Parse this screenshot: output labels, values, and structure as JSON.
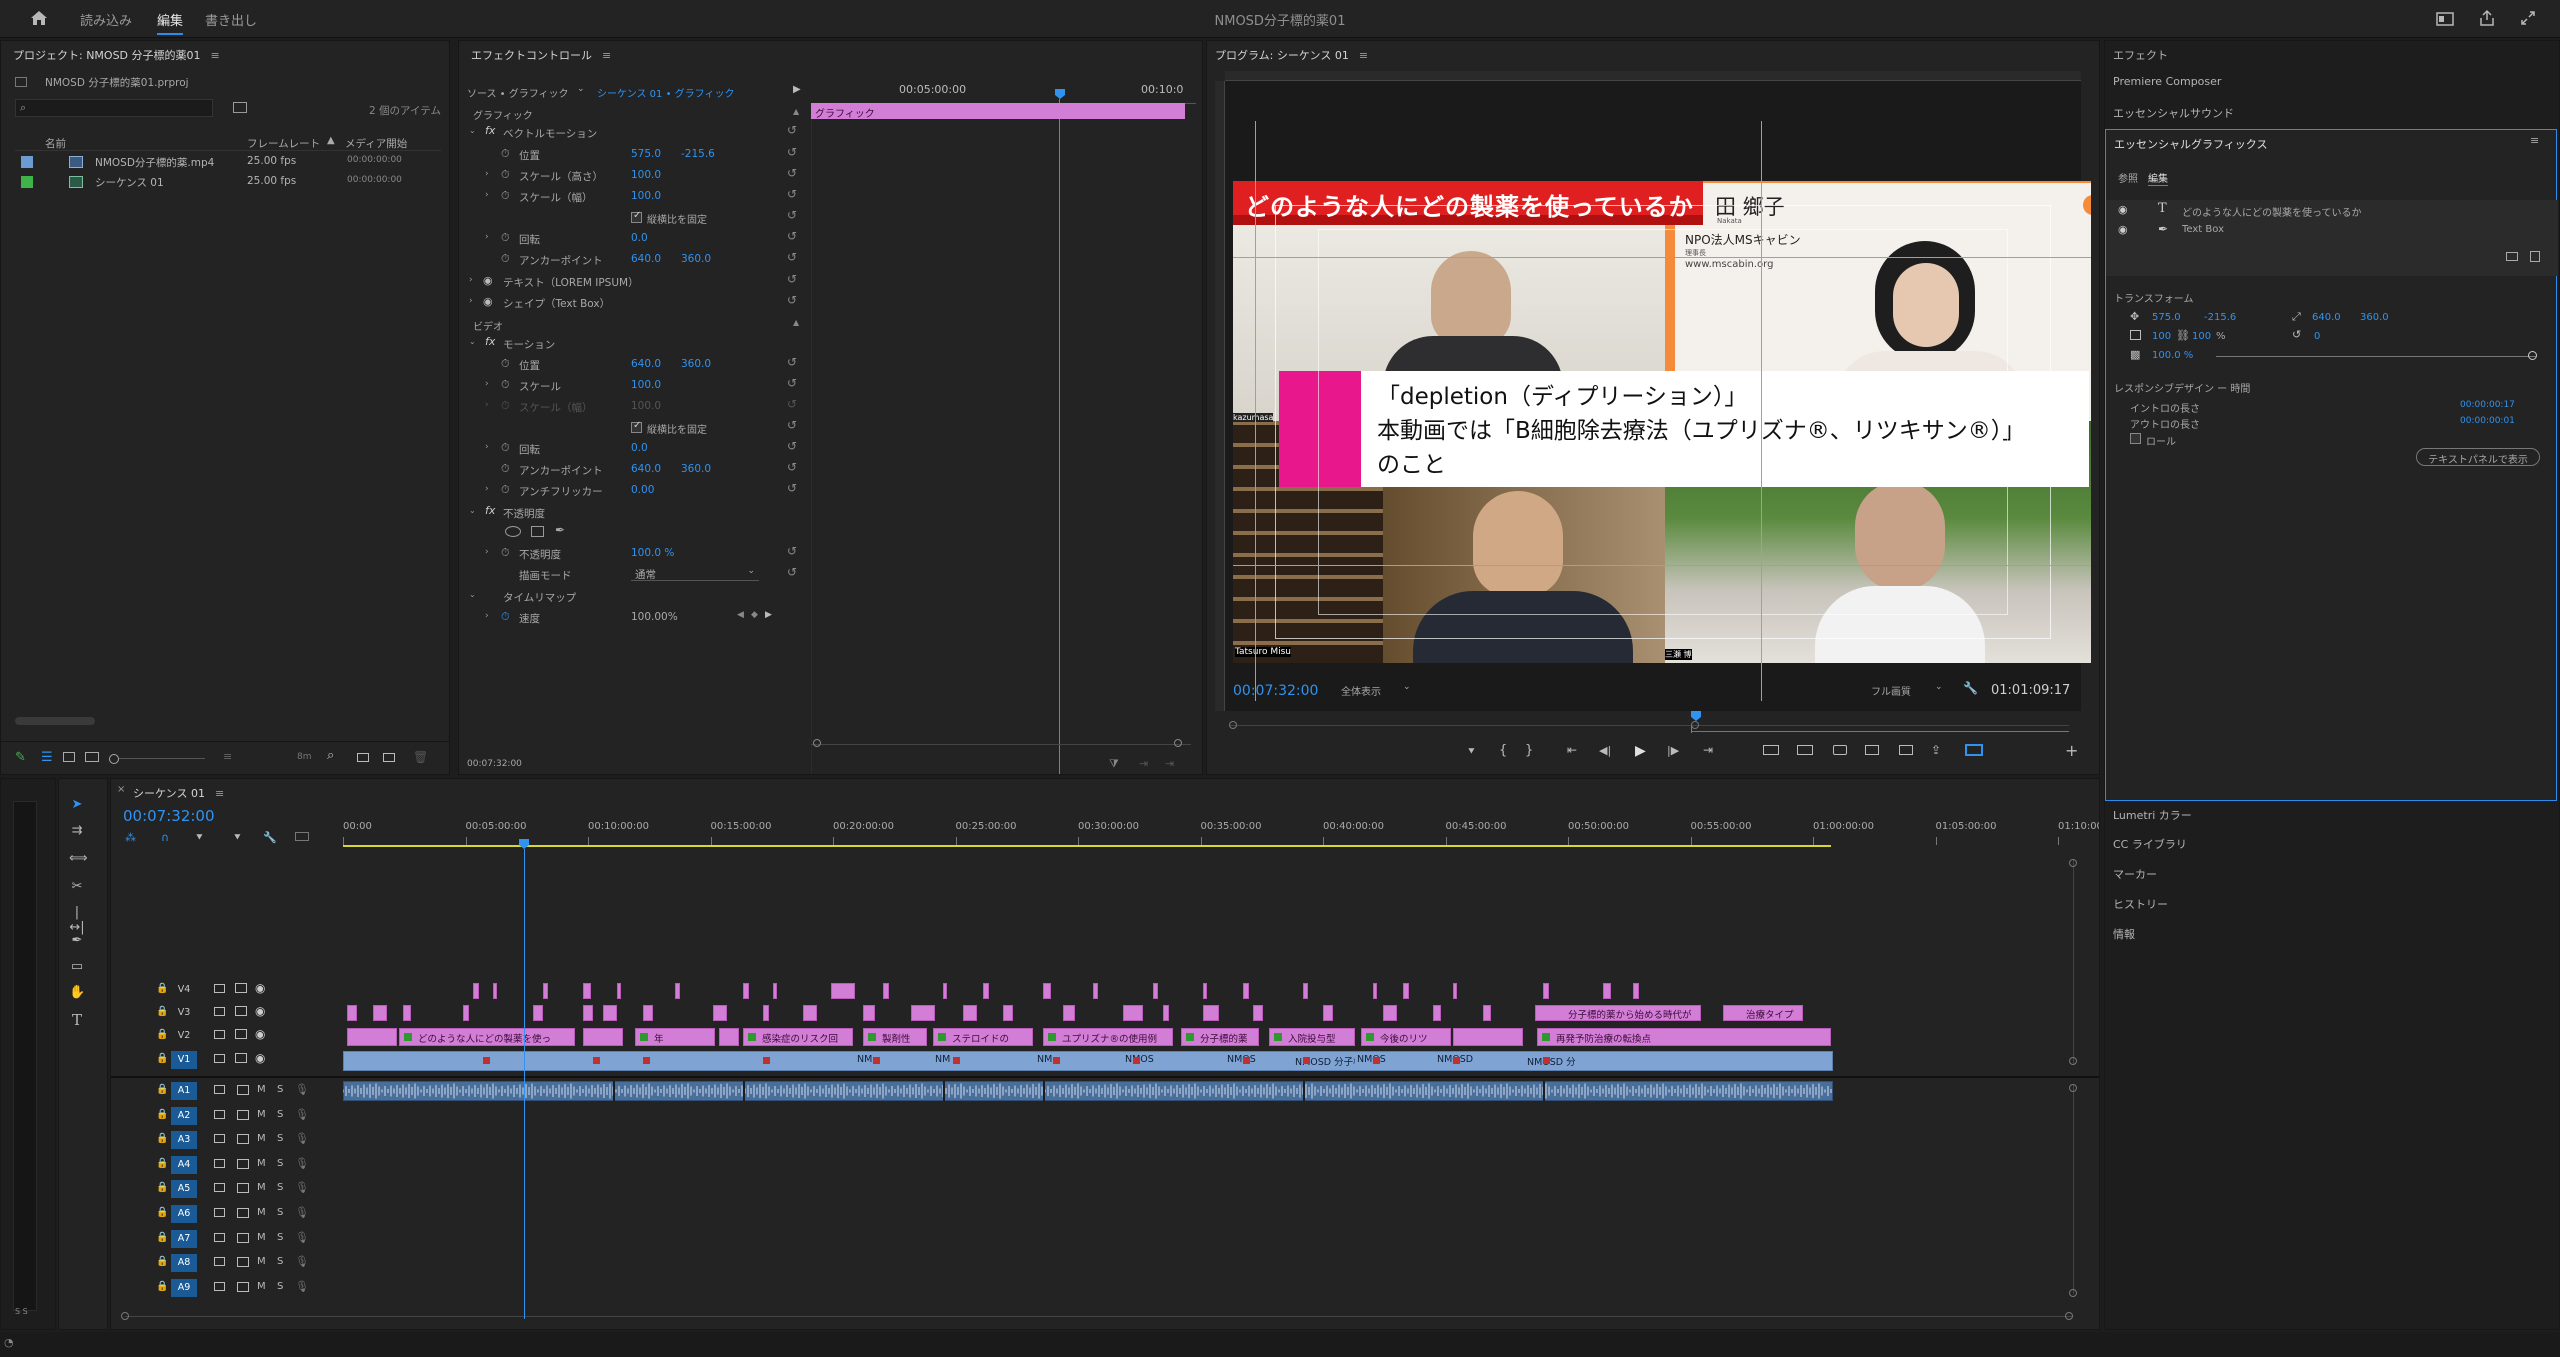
{
  "app": {
    "title": "NMOSD分子標的薬01",
    "workspaces": [
      "読み込み",
      "編集",
      "書き出し"
    ],
    "active_workspace": "編集"
  },
  "project": {
    "title": "プロジェクト: NMOSD 分子標的薬01",
    "file": "NMOSD 分子標的薬01.prproj",
    "item_count": "2 個のアイテム",
    "columns": [
      "名前",
      "フレームレート",
      "メディア開始"
    ],
    "items": [
      {
        "name": "NMOSD分子標的薬.mp4",
        "fps": "25.00 fps",
        "start": "00:00:00:00",
        "color": "#6c9bd2"
      },
      {
        "name": "シーケンス 01",
        "fps": "25.00 fps",
        "start": "00:00:00:00",
        "color": "#3fb24a"
      }
    ],
    "zoom_label": "8m"
  },
  "effect_controls": {
    "title": "エフェクトコントロール",
    "source_label": "ソース • グラフィック",
    "sequence_label": "シーケンス 01 • グラフィック",
    "ruler_time": "00:05:00:00",
    "ruler_time2": "00:10:0",
    "clip_label": "グラフィック",
    "footer_time": "00:07:32:00",
    "section_graphic": "グラフィック",
    "vector_motion": "ベクトルモーション",
    "position_label": "位置",
    "position_x": "575.0",
    "position_y": "-215.6",
    "scale_h_label": "スケール（高さ）",
    "scale_h": "100.0",
    "scale_w_label": "スケール（幅）",
    "scale_w": "100.0",
    "uniform_label": "縦横比を固定",
    "rotation_label": "回転",
    "rotation": "0.0",
    "anchor_label": "アンカーポイント",
    "anchor_x": "640.0",
    "anchor_y": "360.0",
    "text_layer": "テキスト（LOREM IPSUM）",
    "shape_layer": "シェイプ（Text Box）",
    "section_video": "ビデオ",
    "motion": "モーション",
    "v_position_x": "640.0",
    "v_position_y": "360.0",
    "v_scale_label": "スケール",
    "v_scale": "100.0",
    "v_scale_w_label": "スケール（幅）",
    "v_scale_w": "100.0",
    "v_uniform_label": "縦横比を固定",
    "v_rotation": "0.0",
    "v_anchor_x": "640.0",
    "v_anchor_y": "360.0",
    "antiflicker_label": "アンチフリッカー",
    "antiflicker": "0.00",
    "opacity_section": "不透明度",
    "opacity_label": "不透明度",
    "opacity": "100.0 %",
    "blend_label": "描画モード",
    "blend": "通常",
    "timeremap": "タイムリマップ",
    "speed_label": "速度",
    "speed": "100.00%"
  },
  "program": {
    "title": "プログラム: シーケンス 01",
    "timecode": "00:07:32:00",
    "fit_label": "全体表示",
    "quality_label": "フル画質",
    "duration": "01:01:09:17",
    "banner_text": "どのような人にどの製薬を使っているか",
    "name_fragment": "田 鄉子",
    "name_small": "Nakata",
    "org_text": "NPO法人MSキャビン",
    "org_sub": "理事長",
    "url_text": "www.mscabin.org",
    "caption_line1": "「depletion（ディプリーション）」",
    "caption_line2": "本動画では「B細胞除去療法（ユプリズナ®、リツキサン®）」",
    "caption_line3": "のこと",
    "cam_label_left": "kazumasa",
    "cam_label_bottom": "Tatsuro Misu",
    "cam_label_right": "三瀬 博"
  },
  "essential_graphics": {
    "panels_top": [
      "エフェクト",
      "Premiere Composer",
      "エッセンシャルサウンド"
    ],
    "title": "エッセンシャルグラフィックス",
    "tabs": [
      "参照",
      "編集"
    ],
    "active_tab": "編集",
    "layers": [
      {
        "name": "どのような人にどの製薬を使っているか",
        "type": "text"
      },
      {
        "name": "Text Box",
        "type": "shape"
      }
    ],
    "transform_label": "トランスフォーム",
    "pos_x": "575.0",
    "pos_y": "-215.6",
    "anchor_x": "640.0",
    "anchor_y": "360.0",
    "scale": "100",
    "scale2": "100",
    "scale_unit": "%",
    "rotation": "0",
    "opacity": "100.0 %",
    "responsive_label": "レスポンシブデザイン ー 時間",
    "intro_label": "イントロの長さ",
    "intro_value": "00:00:00:17",
    "outro_label": "アウトロの長さ",
    "outro_value": "00:00:00:01",
    "roll_label": "ロール",
    "text_panel_btn": "テキストパネルで表示",
    "panels_bottom": [
      "Lumetri カラー",
      "CC ライブラリ",
      "マーカー",
      "ヒストリー",
      "情報"
    ]
  },
  "timeline": {
    "title": "シーケンス 01",
    "timecode": "00:07:32:00",
    "ruler": [
      "00:00",
      "00:05:00:00",
      "00:10:00:00",
      "00:15:00:00",
      "00:20:00:00",
      "00:25:00:00",
      "00:30:00:00",
      "00:35:00:00",
      "00:40:00:00",
      "00:45:00:00",
      "00:50:00:00",
      "00:55:00:00",
      "01:00:00:00",
      "01:05:00:00",
      "01:10:00:00"
    ],
    "video_tracks": [
      "V4",
      "V3",
      "V2",
      "V1"
    ],
    "audio_tracks": [
      "A1",
      "A2",
      "A3",
      "A4",
      "A5",
      "A6",
      "A7",
      "A8",
      "A9"
    ],
    "track_m": "M",
    "track_s": "S",
    "v3_clips": [
      {
        "label": "分子標的薬から始める時代が"
      },
      {
        "label": "治療タイプ"
      }
    ],
    "v2_clips": [
      {
        "label": "どのような人にどの製薬を使っ"
      },
      {
        "label": "年"
      },
      {
        "label": "感染症のリスク回"
      },
      {
        "label": "製剤性"
      },
      {
        "label": "ステロイドの"
      },
      {
        "label": "ユプリズナ®の使用例"
      },
      {
        "label": "分子標的薬"
      },
      {
        "label": "入院投与型"
      },
      {
        "label": "今後のリツ"
      },
      {
        "label": "再発予防治療の転換点"
      }
    ],
    "v1_labels": [
      "NM",
      "NM",
      "NM",
      "NMOS",
      "NMOS",
      "NMOSD 分子標",
      "NMOS",
      "NMOSD",
      "NMOSD 分"
    ],
    "meter_label": "S S"
  }
}
